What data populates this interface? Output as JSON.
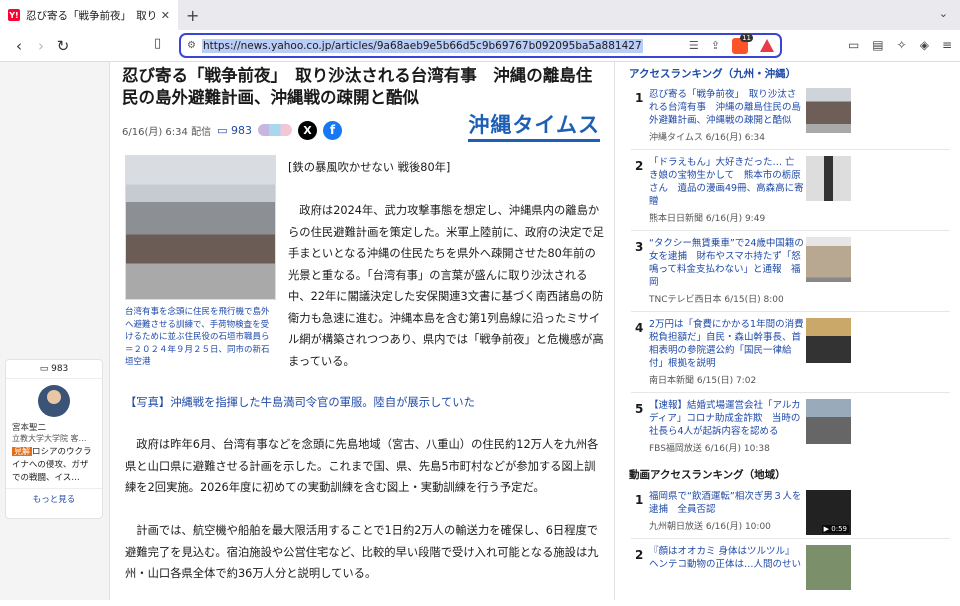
{
  "browser": {
    "tab_title": "忍び寄る「戦争前夜」　取り沙汰",
    "url": "https://news.yahoo.co.jp/articles/9a68aeb9e5b66d5c9b69767b092095ba5a881427",
    "shield_count": "11"
  },
  "article": {
    "title": "忍び寄る「戦争前夜」　取り沙汰される台湾有事　沖縄の離島住民の島外避難計画、沖縄戦の疎開と酷似",
    "date": "6/16(月) 6:34 配信",
    "comment_count": "983",
    "publisher_logo": "沖縄タイムス",
    "subhead": "[鉄の暴風吹かせない 戦後80年]",
    "lead": "政府は2024年、武力攻撃事態を想定し、沖縄県内の離島からの住民避難計画を策定した。米軍上陸前に、政府の決定で足手まといとなる沖縄の住民たちを県外へ疎開させた80年前の光景と重なる。「台湾有事」の言葉が盛んに取り沙汰される中、22年に閣議決定した安保関連3文書に基づく南西諸島の防衛力も急速に進む。沖縄本島を含む第1列島線に沿ったミサイル網が構築されつつあり、県内では「戦争前夜」と危機感が高まっている。",
    "caption": "台湾有事を念頭に住民を飛行機で島外へ避難させる訓練で、手荷物検査を受けるために並ぶ住民役の石垣市職員ら＝２０２４年９月２５日、同市の新石垣空港",
    "photo_link": "【写真】沖縄戦を指揮した牛島満司令官の軍服。陸自が展示していた",
    "para1": "政府は昨年6月、台湾有事などを念頭に先島地域（宮古、八重山）の住民約12万人を九州各県と山口県に避難させる計画を示した。これまで国、県、先島5市町村などが参加する図上訓練を2回実施。2026年度に初めての実動訓練を含む図上・実動訓練を行う予定だ。",
    "para2": "計画では、航空機や船舶を最大限活用することで1日約2万人の輸送力を確保し、6日程度で避難完了を見込む。宿泊施設や公営住宅など、比較的早い段階で受け入れ可能となる施設は九州・山口各県全体で約36万人分と説明している。"
  },
  "comment_card": {
    "count": "983",
    "name": "宮本聖二",
    "org": "立教大学大学院 客…",
    "badge": "見解",
    "text": "ロシアのウクライナへの侵攻、ガザでの戦闘、イス…",
    "more": "もっと見る"
  },
  "ranking": {
    "title": "アクセスランキング（九州・沖縄）",
    "items": [
      {
        "num": "1",
        "text": "忍び寄る「戦争前夜」　取り沙汰される台湾有事　沖縄の離島住民の島外避難計画、沖縄戦の疎開と酷似",
        "src": "沖縄タイムス 6/16(月) 6:34"
      },
      {
        "num": "2",
        "text": "「ドラえもん」大好きだった… 亡き娘の宝物生かして　熊本市の栃原さん　遺品の漫画49冊、高森高に寄贈",
        "src": "熊本日日新聞 6/16(月) 9:49"
      },
      {
        "num": "3",
        "text": "“タクシー無賃乗車”で24歳中国籍の女を逮捕　財布やスマホ持たず「怒鳴って料金支払わない」と通報　福岡",
        "src": "TNCテレビ西日本 6/15(日) 8:00"
      },
      {
        "num": "4",
        "text": "2万円は「食費にかかる1年間の消費税負担額だ」自民・森山幹事長、首相表明の参院選公約「国民一律給付」根拠を説明",
        "src": "南日本新聞 6/15(日) 7:02"
      },
      {
        "num": "5",
        "text": "【速報】結婚式場運営会社「アルカディア」コロナ助成金詐欺　当時の社長ら4人が起訴内容を認める",
        "src": "FBS福岡放送 6/16(月) 10:38"
      }
    ]
  },
  "video_ranking": {
    "title": "動画アクセスランキング（地域）",
    "items": [
      {
        "num": "1",
        "text": "福岡県で“飲酒運転”相次ぎ男３人を逮捕　全員否認",
        "src": "九州朝日放送 6/16(月) 10:00",
        "duration": "▶ 0:59"
      },
      {
        "num": "2",
        "text": "『顔はオオカミ 身体はツルツル』ヘンテコ動物の正体は…人間のせい",
        "src": ""
      }
    ]
  }
}
